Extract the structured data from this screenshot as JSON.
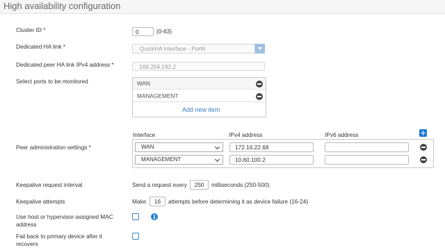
{
  "page": {
    "title": "High availability configuration"
  },
  "cluster_id": {
    "label": "Cluster ID *",
    "value": "0",
    "range": "(0-63)"
  },
  "ha_link": {
    "label": "Dedicated HA link *",
    "value": "QuickHA Interface - Port6"
  },
  "peer_ipv4": {
    "label": "Dedicated peer HA link IPv4 address *",
    "value": "169.254.192.2"
  },
  "monitored_ports": {
    "label": "Select ports to be monitored",
    "items": [
      "WAN",
      "MANAGEMENT"
    ],
    "add_label": "Add new item"
  },
  "peer_admin": {
    "label": "Peer administration settings *",
    "columns": {
      "interface": "Interface",
      "ipv4": "IPv4 address",
      "ipv6": "IPv6 address"
    },
    "rows": [
      {
        "interface": "WAN",
        "ipv4": "172.16.22.68",
        "ipv6": ""
      },
      {
        "interface": "MANAGEMENT",
        "ipv4": "10.60.100.2",
        "ipv6": ""
      }
    ]
  },
  "keepalive_interval": {
    "label": "Keepalive request interval",
    "prefix": "Send a request every",
    "value": "250",
    "suffix": "milliseconds (250-500)"
  },
  "keepalive_attempts": {
    "label": "Keepalive attempts",
    "prefix": "Make",
    "value": "16",
    "suffix": "attempts before determining it as device failure (16-24)"
  },
  "mac_address": {
    "label": "Use host or hypervisor-assigned MAC address",
    "checked": false
  },
  "fail_back": {
    "label": "Fail back to primary device after it recovers",
    "checked": false
  }
}
